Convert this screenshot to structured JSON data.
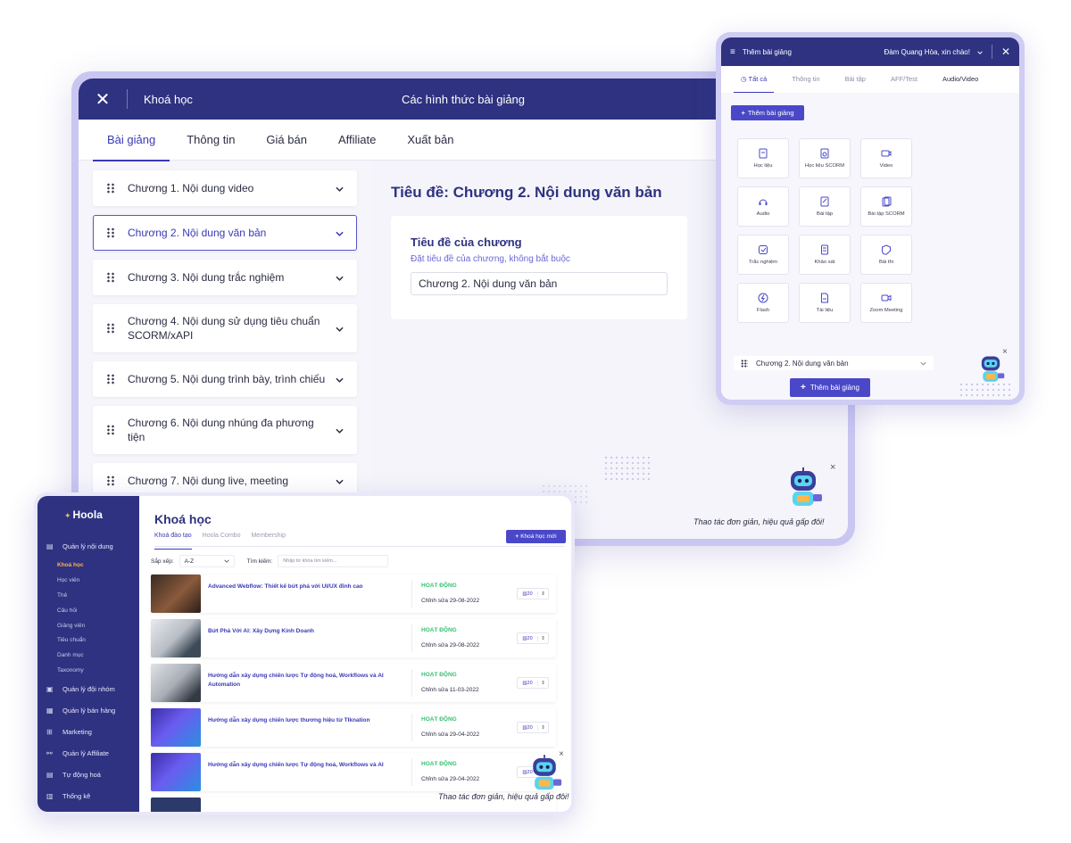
{
  "lesson_window": {
    "header": {
      "close_icon": "✕",
      "title": "Khoá học",
      "center_title": "Các hình thức bài giảng"
    },
    "tabs": [
      "Bài giảng",
      "Thông tin",
      "Giá bán",
      "Affiliate",
      "Xuất bản"
    ],
    "active_tab": 0,
    "chapters": [
      "Chương 1. Nội dung video",
      "Chương 2. Nội dung văn bản",
      "Chương 3. Nội dung trắc nghiệm",
      "Chương 4. Nội dung sử dụng tiêu chuẩn SCORM/xAPI",
      "Chương 5. Nội dung trình bày, trình chiếu",
      "Chương 6. Nội dung nhúng đa phương tiện",
      "Chương 7. Nội dung live, meeting"
    ],
    "active_chapter": 1,
    "editor": {
      "heading": "Tiêu đề: Chương 2. Nội dung văn bản",
      "field_label": "Tiêu đề của chương",
      "field_hint": "Đặt tiêu đề của chương, không bắt buộc",
      "field_value": "Chương 2. Nội dung văn bản"
    },
    "tagline": "Thao tác đơn giản, hiệu quả gấp đôi!",
    "close_glyph": "×"
  },
  "add_panel": {
    "menu_icon": "≡",
    "title": "Thêm bài giảng",
    "greeting": "Đàm Quang Hòa, xin chào!",
    "close_icon": "✕",
    "tabs": [
      "Tất cả",
      "Thông tin",
      "Bài tập",
      "AFF/Test",
      "Audio/Video"
    ],
    "active_tab": 0,
    "top_button": "Thêm bài giảng",
    "types": [
      {
        "label": "Học liệu",
        "icon": "doc-icon"
      },
      {
        "label": "Học liệu SCORM",
        "icon": "scorm-icon"
      },
      {
        "label": "Video",
        "icon": "video-icon"
      },
      {
        "label": "Audio",
        "icon": "audio-icon"
      },
      {
        "label": "Bài tập",
        "icon": "exercise-icon"
      },
      {
        "label": "Bài tập SCORM",
        "icon": "exercise-scorm-icon"
      },
      {
        "label": "Trắc nghiệm",
        "icon": "quiz-icon"
      },
      {
        "label": "Khảo sát",
        "icon": "survey-icon"
      },
      {
        "label": "Bài thi",
        "icon": "exam-icon"
      },
      {
        "label": "Flash",
        "icon": "flash-icon"
      },
      {
        "label": "Tài liệu",
        "icon": "document-icon"
      },
      {
        "label": "Zoom Meeting",
        "icon": "zoom-icon"
      }
    ],
    "select_value": "Chương 2. Nội dung văn bản",
    "bottom_button": "Thêm bài giảng",
    "close_glyph": "×"
  },
  "courses_window": {
    "logo": "Hoola",
    "sidebar": {
      "group_label": "Quản lý nội dung",
      "sub_items": [
        "Khoá học",
        "Học viên",
        "Thẻ",
        "Câu hỏi",
        "Giảng viên",
        "Tiêu chuẩn",
        "Danh mục",
        "Taxonomy"
      ],
      "active_sub": 0,
      "main_items": [
        "Quản lý đội nhóm",
        "Quản lý bán hàng",
        "Marketing",
        "Quản lý Affiliate",
        "Tự động hoá",
        "Thống kê"
      ]
    },
    "title": "Khoá học",
    "tabs": [
      "Khoá đào tạo",
      "Hoola Combo",
      "Membership"
    ],
    "active_tab": 0,
    "new_button": "Khoá học mới",
    "sort_label": "Sắp xếp:",
    "sort_value": "A-Z",
    "search_label": "Tìm kiếm:",
    "search_placeholder": "Nhập từ khóa tìm kiếm...",
    "courses": [
      {
        "name": "Advanced Webflow: Thiết kế bứt phá với UI/UX đỉnh cao",
        "status": "HOẠT ĐỘNG",
        "edited": "Chỉnh sửa 29-08-2022",
        "count": "20"
      },
      {
        "name": "Bứt Phá Với AI: Xây Dựng Kinh Doanh",
        "status": "HOẠT ĐỘNG",
        "edited": "Chỉnh sửa 29-08-2022",
        "count": "20"
      },
      {
        "name": "Hướng dẫn xây dựng chiến lược Tự động hoá, Workflows và AI Automation",
        "status": "HOẠT ĐỘNG",
        "edited": "Chỉnh sửa 11-03-2022",
        "count": "20"
      },
      {
        "name": "Hướng dẫn xây dựng chiến lược thương hiệu từ TIknation",
        "status": "HOẠT ĐỘNG",
        "edited": "Chỉnh sửa 29-04-2022",
        "count": "20"
      },
      {
        "name": "Hướng dẫn xây dựng chiến lược Tự động hoá, Workflows và AI",
        "status": "HOẠT ĐỘNG",
        "edited": "Chỉnh sửa 29-04-2022",
        "count": "20"
      }
    ],
    "tagline": "Thao tác đơn giản, hiệu quả gấp đôi!",
    "close_glyph": "×"
  },
  "colors": {
    "navy": "#2e3280",
    "accent": "#3a39b5",
    "status_green": "#38c172",
    "sidebar_active": "#ffb648"
  }
}
